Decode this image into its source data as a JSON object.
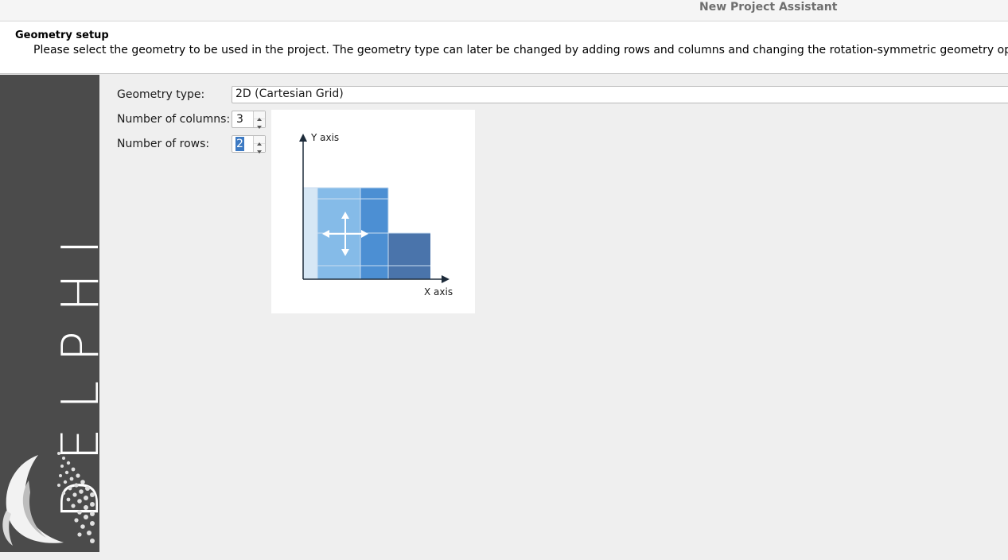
{
  "window": {
    "title": "New Project Assistant"
  },
  "header": {
    "title": "Geometry setup",
    "description": "Please select the geometry to be used in the project. The geometry type can later be changed by adding rows and columns and changing the rotation-symmetric geometry option."
  },
  "sidebar": {
    "brand": "DELPHIN"
  },
  "form": {
    "geometry_type_label": "Geometry type:",
    "geometry_type_value": "2D (Cartesian Grid)",
    "columns_label": "Number of columns:",
    "columns_value": "3",
    "rows_label": "Number of rows:",
    "rows_value": "2"
  },
  "preview": {
    "y_axis_label": "Y axis",
    "x_axis_label": "X axis",
    "move_icon": "move-arrows-icon"
  },
  "colors": {
    "sidebar_bg": "#4b4b4b",
    "cell_light": "#d6e7f5",
    "cell_mid": "#85bbe8",
    "cell_strong": "#4c8fd3",
    "cell_dark": "#4a74ab",
    "selection": "#3d7ac3"
  }
}
